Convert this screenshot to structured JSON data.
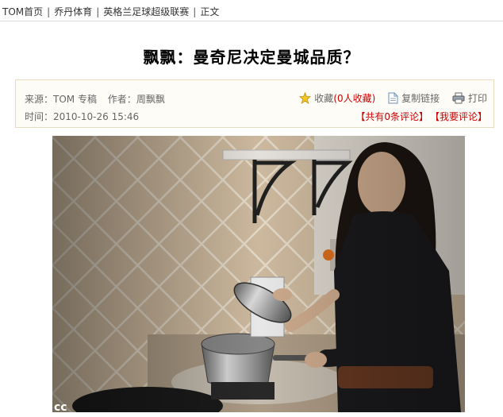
{
  "breadcrumb": {
    "items": [
      "TOM首页",
      "乔丹体育",
      "英格兰足球超级联赛",
      "正文"
    ],
    "separator": "|"
  },
  "article": {
    "title": "飘飘：曼奇尼决定曼城品质？"
  },
  "meta": {
    "source_label": "来源：",
    "source": "TOM 专稿",
    "author_label": "作者：",
    "author": "周飘飘",
    "time_label": "时间：",
    "time": "2010-10-26 15:46"
  },
  "tools": {
    "favorite_label": "收藏",
    "favorite_count": "(0人收藏)",
    "copy_link_label": "复制链接",
    "print_label": "打印"
  },
  "comments": {
    "total_link": "【共有0条评论】",
    "post_link": "【我要评论】"
  },
  "photo": {
    "corner_mark": "cc"
  },
  "colors": {
    "link_red": "#c00000",
    "meta_border": "#e8dcc0",
    "meta_bg": "#fdfcf7"
  }
}
